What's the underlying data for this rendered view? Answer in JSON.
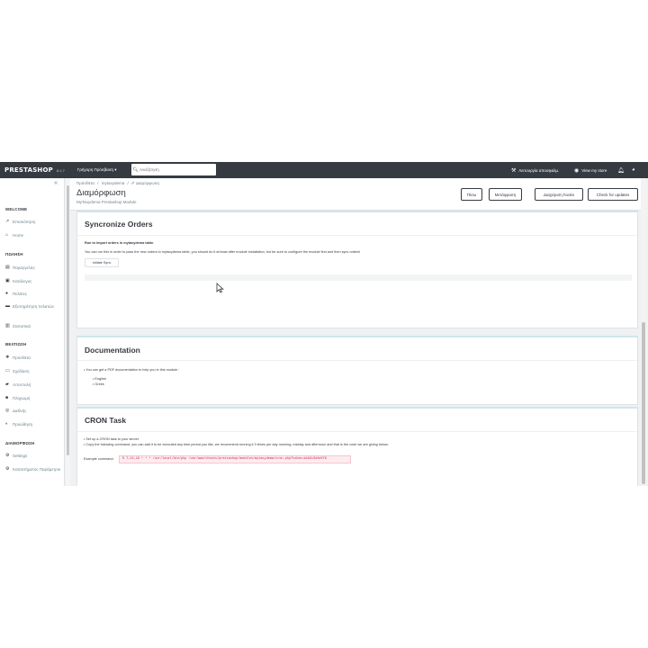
{
  "topbar": {
    "logo": "PRESTASHOP",
    "version": "8.1.7",
    "quick_access": "Γρήγορη Πρόσβαση ▾",
    "search_placeholder": "Αναζήτηση",
    "maintenance": "Λειτουργία αποσφαλμ.",
    "view_store": "View my store"
  },
  "sidebar": {
    "sections": [
      {
        "title": "WELCOME",
        "items": [
          {
            "label": "Επισκόπηση",
            "icon": "trend-icon"
          },
          {
            "label": "Home",
            "icon": "home-icon"
          }
        ]
      },
      {
        "title": "ΠΩΛΗΣΗ",
        "items": [
          {
            "label": "Παραγγελίες",
            "icon": "cart-icon"
          },
          {
            "label": "Κατάλογος",
            "icon": "store-icon"
          },
          {
            "label": "Πελάτες",
            "icon": "user-icon"
          },
          {
            "label": "Εξυπηρέτηση πελατών",
            "icon": "chat-icon"
          },
          {
            "label": "Στατιστικά",
            "icon": "stats-icon"
          }
        ]
      },
      {
        "title": "ΒΕΛΤΙΩΣΗ",
        "items": [
          {
            "label": "Πρόσθετα",
            "icon": "puzzle-icon"
          },
          {
            "label": "Σχεδίαση",
            "icon": "desktop-icon"
          },
          {
            "label": "Αποστολή",
            "icon": "truck-icon"
          },
          {
            "label": "Πληρωμή",
            "icon": "card-icon"
          },
          {
            "label": "Διεθνής",
            "icon": "globe-icon"
          },
          {
            "label": "Προώθηση",
            "icon": "promo-icon"
          }
        ]
      },
      {
        "title": "ΔΙΑΜΟΡΦΩΣΗ",
        "items": [
          {
            "label": "Settings",
            "icon": "gear-icon"
          },
          {
            "label": "Καταστήματος Παράμετροι",
            "icon": "gear-icon"
          }
        ]
      }
    ]
  },
  "header": {
    "breadcrumb": [
      "Πρόσθετα",
      "/",
      "mytaxydema",
      "/",
      "✐ Διαμόρφωση"
    ],
    "title": "Διαμόρφωση",
    "subtitle": "MyTaxydema Prestashop Module",
    "buttons": [
      "Πίσω",
      "Μετάφραση",
      "Διαχείριση hooks",
      "Check for updates"
    ]
  },
  "sync": {
    "title": "Syncronize Orders",
    "heading": "Run to import orders in mytaxydema table.",
    "text": "You can run this in order to pass the new orders to mytaxydema table, you should do it at least after module installation, but be sure to configure the module first and then sync orders!",
    "button": "Initiate Sync"
  },
  "docs": {
    "title": "Documentation",
    "intro": "• You can get a PDF documentation to help you in this module :",
    "links": [
      "English",
      "Greek"
    ]
  },
  "cron": {
    "title": "CRON Task",
    "line1": "• Set up a CRON task to your server.",
    "line2": "• Copy the following command, you can add it to be executed any time period you like, we recommend running it 3 times per day morning, midday and afternoon and that is the code we are giving below:",
    "label": "Example command:",
    "command": "0 7,12,18 * * * /usr/local/bin/php /var/www/vhosts/prestashop/modules/mytaxydema/cron.php?token=a1b2c3d4e5f6"
  }
}
